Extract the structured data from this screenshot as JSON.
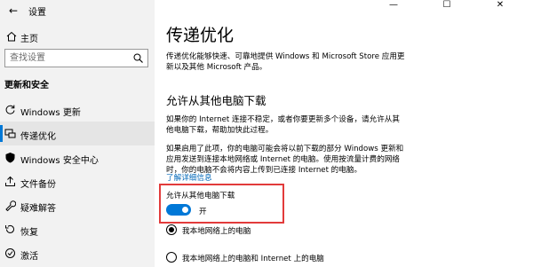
{
  "window": {
    "title": "设置",
    "back_glyph": "←",
    "minimize_glyph": "—",
    "maximize_glyph": "☐",
    "close_glyph": "✕"
  },
  "sidebar": {
    "home_label": "主页",
    "search_placeholder": "查找设置",
    "section_title": "更新和安全",
    "items": [
      {
        "label": "Windows 更新",
        "icon": "refresh-icon"
      },
      {
        "label": "传递优化",
        "icon": "delivery-optimization-icon",
        "active": true
      },
      {
        "label": "Windows 安全中心",
        "icon": "shield-icon"
      },
      {
        "label": "文件备份",
        "icon": "backup-icon"
      },
      {
        "label": "疑难解答",
        "icon": "wrench-icon"
      },
      {
        "label": "恢复",
        "icon": "recovery-icon"
      },
      {
        "label": "激活",
        "icon": "activation-icon"
      }
    ]
  },
  "main": {
    "title": "传递优化",
    "description": "传递优化能够快速、可靠地提供 Windows 和 Microsoft Store 应用更新以及其他 Microsoft 产品。",
    "sub_heading": "允许从其他电脑下载",
    "info_paragraph_1": "如果你的 Internet 连接不稳定，或者你要更新多个设备，请允许从其他电脑下载，帮助加快此过程。",
    "info_paragraph_2": "如果启用了此项，你的电脑可能会将以前下载的部分 Windows 更新和应用发送到连接本地网络或 Internet 的电脑。使用按流量计费的网络时，你的电脑不会将内容上传到已连接 Internet 的电脑。",
    "link_text": "了解详细信息",
    "toggle": {
      "label": "允许从其他电脑下载",
      "state_text": "开",
      "on": true,
      "color": "#0078d7"
    },
    "radio_options": [
      {
        "label": "我本地网络上的电脑",
        "checked": true
      },
      {
        "label": "我本地网络上的电脑和 Internet 上的电脑",
        "checked": false
      }
    ]
  },
  "colors": {
    "accent": "#0078d7",
    "link": "#0067b8",
    "highlight": "#e23b3b",
    "sidebar_bg": "#f2f2f2"
  }
}
